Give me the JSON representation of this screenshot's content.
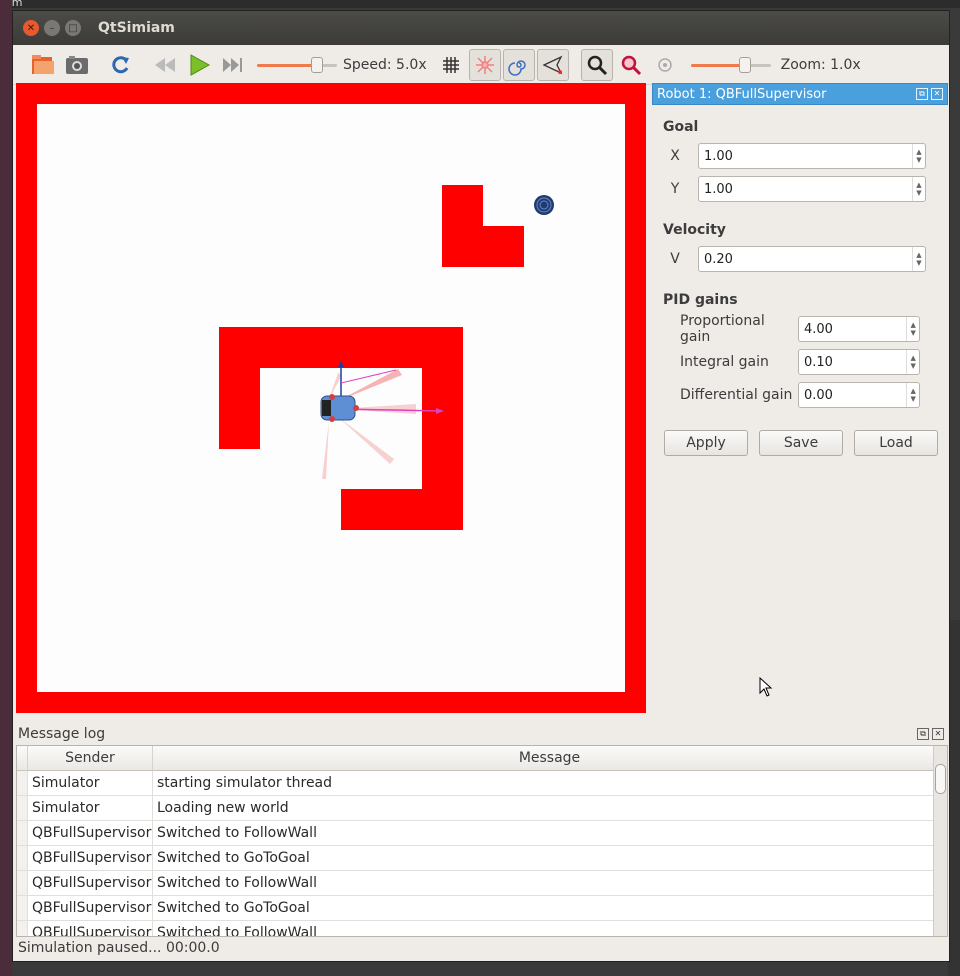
{
  "window": {
    "title": "QtSimiam"
  },
  "desktop": {
    "corner_text": "iam"
  },
  "toolbar": {
    "speed_label": "Speed: 5.0x",
    "speed_level": 0.8,
    "zoom_label": "Zoom: 1.0x",
    "zoom_level": 0.7,
    "icons": [
      "folder-open-icon",
      "screenshot-icon",
      "reload-icon",
      "rewind-icon",
      "play-icon",
      "fast-forward-icon",
      "grid-icon",
      "sensors-icon",
      "trajectory-icon",
      "supervisor-icon",
      "zoom-fit-icon",
      "zoom-robot-icon",
      "rotate-icon"
    ]
  },
  "robot_panel": {
    "title": "Robot 1: QBFullSupervisor",
    "goal": {
      "heading": "Goal",
      "x_label": "X",
      "x_value": "1.00",
      "y_label": "Y",
      "y_value": "1.00"
    },
    "velocity": {
      "heading": "Velocity",
      "v_label": "V",
      "v_value": "0.20"
    },
    "pid": {
      "heading": "PID gains",
      "kp_label": "Proportional gain",
      "kp_value": "4.00",
      "ki_label": "Integral gain",
      "ki_value": "0.10",
      "kd_label": "Differential gain",
      "kd_value": "0.00"
    },
    "buttons": {
      "apply": "Apply",
      "save": "Save",
      "load": "Load"
    }
  },
  "message_log": {
    "title": "Message log",
    "columns": {
      "sender": "Sender",
      "message": "Message"
    },
    "rows": [
      {
        "sender": "Simulator",
        "message": "starting simulator thread"
      },
      {
        "sender": "Simulator",
        "message": "Loading new world"
      },
      {
        "sender": "QBFullSupervisor",
        "message": "Switched to FollowWall"
      },
      {
        "sender": "QBFullSupervisor",
        "message": "Switched to GoToGoal"
      },
      {
        "sender": "QBFullSupervisor",
        "message": "Switched to FollowWall"
      },
      {
        "sender": "QBFullSupervisor",
        "message": "Switched to GoToGoal"
      },
      {
        "sender": "QBFullSupervisor",
        "message": "Switched to FollowWall"
      }
    ]
  },
  "status": {
    "text": "Simulation paused... 00:00.0"
  },
  "colors": {
    "wall": "#ff0000",
    "accent": "#4a9fdd",
    "slider": "#ef7a4c",
    "goal": "#1f3b73"
  }
}
